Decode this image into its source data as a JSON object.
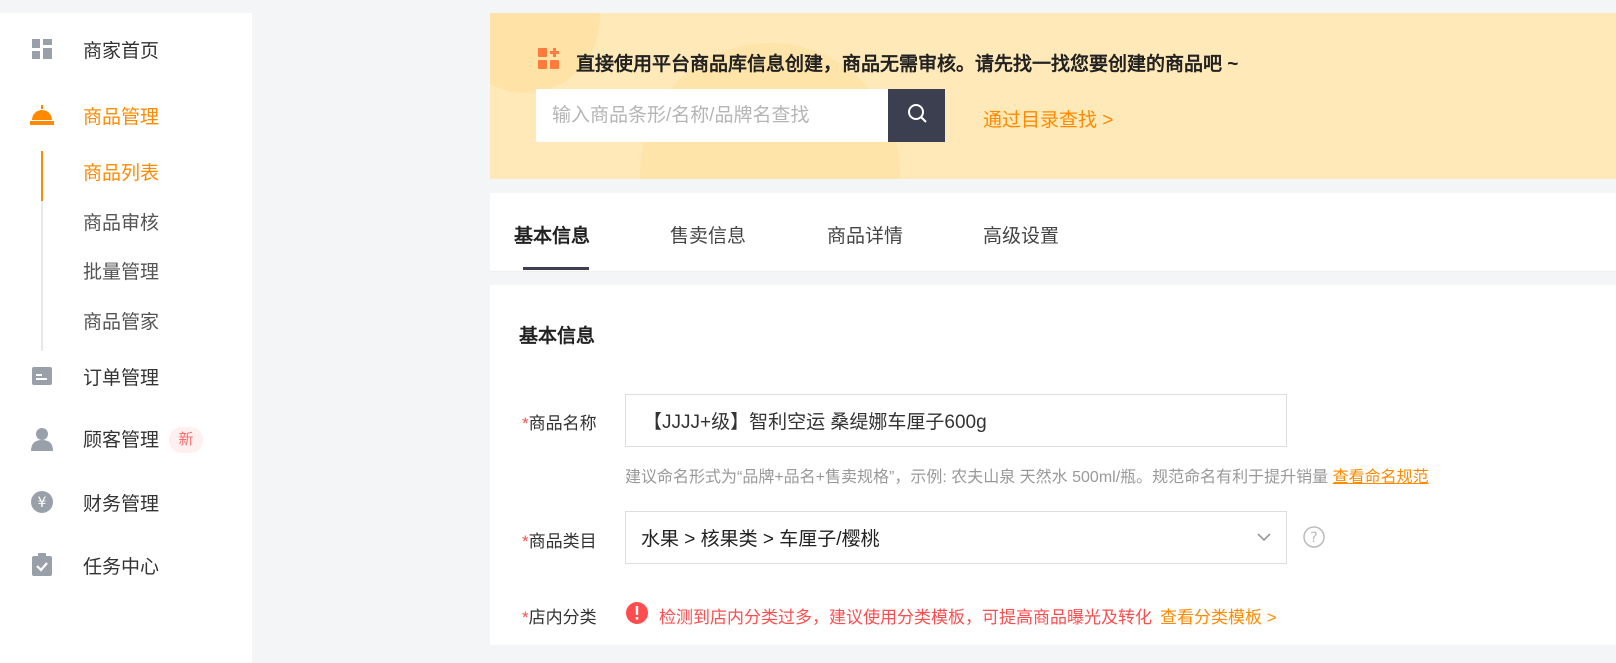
{
  "sidebar": {
    "items": [
      {
        "label": "商家首页",
        "icon": "dashboard-icon"
      },
      {
        "label": "商品管理",
        "icon": "product-icon"
      },
      {
        "label": "订单管理",
        "icon": "order-icon"
      },
      {
        "label": "顾客管理",
        "icon": "customer-icon",
        "badge": "新"
      },
      {
        "label": "财务管理",
        "icon": "finance-icon"
      },
      {
        "label": "任务中心",
        "icon": "task-icon"
      }
    ],
    "sub_items": [
      {
        "label": "商品列表"
      },
      {
        "label": "商品审核"
      },
      {
        "label": "批量管理"
      },
      {
        "label": "商品管家"
      }
    ]
  },
  "banner": {
    "title": "直接使用平台商品库信息创建，商品无需审核。请先找一找您要创建的商品吧 ~",
    "search_placeholder": "输入商品条形/名称/品牌名查找",
    "catalog_link": "通过目录查找 >"
  },
  "tabs": [
    {
      "label": "基本信息"
    },
    {
      "label": "售卖信息"
    },
    {
      "label": "商品详情"
    },
    {
      "label": "高级设置"
    }
  ],
  "form": {
    "section_title": "基本信息",
    "name": {
      "required_mark": "*",
      "label": "商品名称",
      "value": "【JJJJ+级】智利空运 桑缇娜车厘子600g",
      "hint": "建议命名形式为“品牌+品名+售卖规格”，示例: 农夫山泉 天然水 500ml/瓶。规范命名有利于提升销量",
      "hint_link": "查看命名规范"
    },
    "category": {
      "required_mark": "*",
      "label": "商品类目",
      "value": "水果 > 核果类 > 车厘子/樱桃"
    },
    "shop_category": {
      "required_mark": "*",
      "label": "店内分类",
      "warning": "检测到店内分类过多，建议使用分类模板，可提高商品曝光及转化",
      "warning_link": "查看分类模板 >"
    }
  },
  "colors": {
    "accent": "#ff8a00",
    "banner_bg": "#ffe9b8",
    "dark_button": "#3c3f4f",
    "error": "#ff4d4f"
  }
}
